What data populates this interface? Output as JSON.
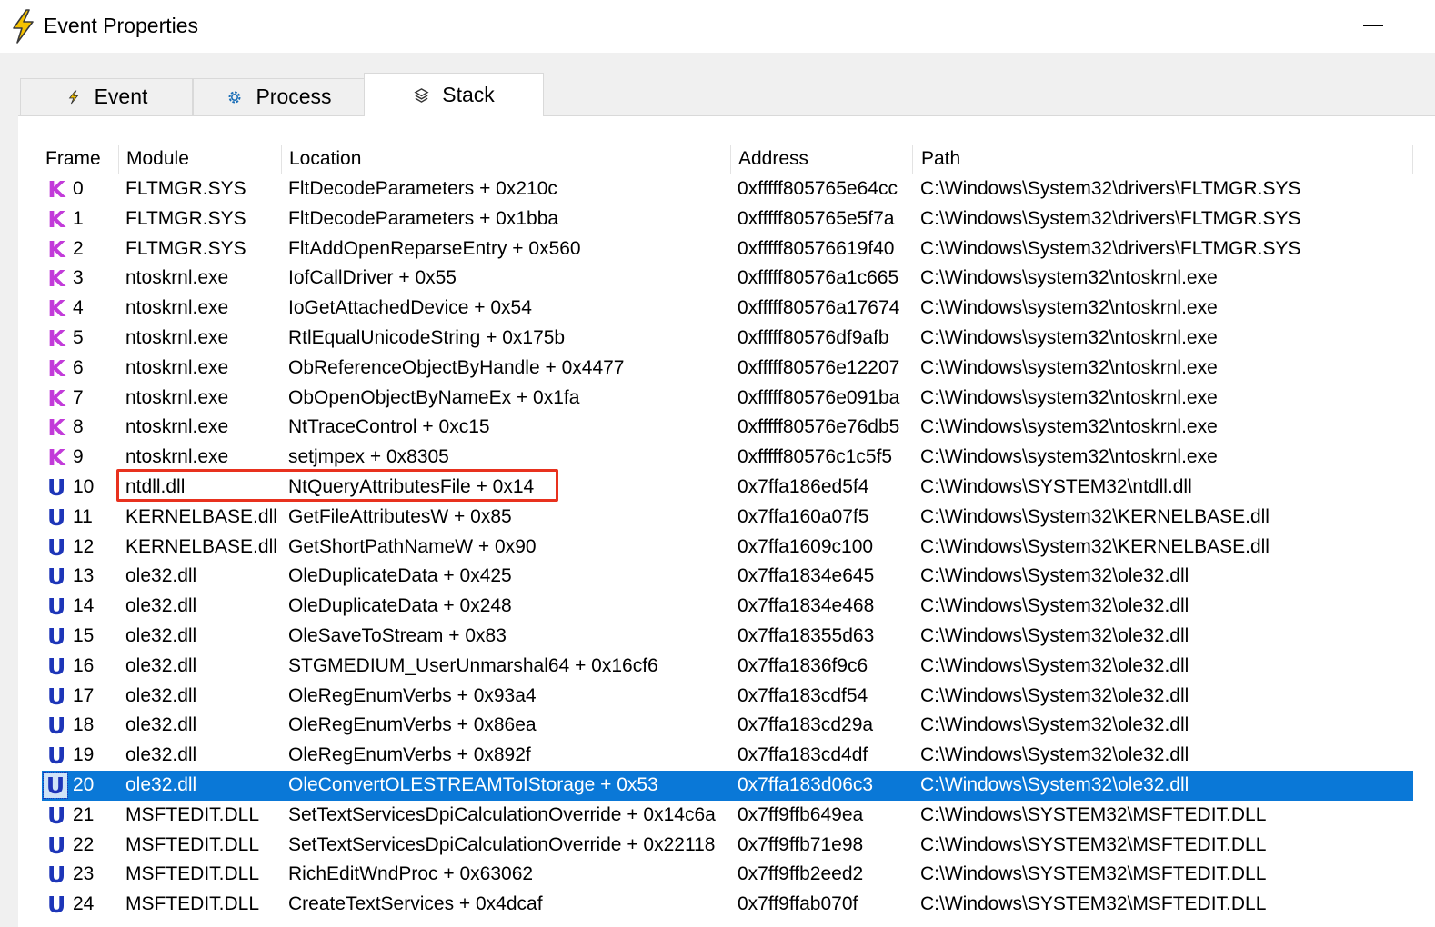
{
  "window": {
    "title": "Event Properties",
    "icon": "lightning-icon"
  },
  "tabs": [
    {
      "label": "Event",
      "icon": "lightning-icon",
      "active": false
    },
    {
      "label": "Process",
      "icon": "gear-icon",
      "active": false
    },
    {
      "label": "Stack",
      "icon": "layers-icon",
      "active": true
    }
  ],
  "table": {
    "columns": [
      "Frame",
      "Module",
      "Location",
      "Address",
      "Path"
    ],
    "selected_frame": "20",
    "highlighted_frame": "10",
    "rows": [
      {
        "mode": "K",
        "frame": "0",
        "module": "FLTMGR.SYS",
        "location": "FltDecodeParameters + 0x210c",
        "address": "0xfffff805765e64cc",
        "path": "C:\\Windows\\System32\\drivers\\FLTMGR.SYS"
      },
      {
        "mode": "K",
        "frame": "1",
        "module": "FLTMGR.SYS",
        "location": "FltDecodeParameters + 0x1bba",
        "address": "0xfffff805765e5f7a",
        "path": "C:\\Windows\\System32\\drivers\\FLTMGR.SYS"
      },
      {
        "mode": "K",
        "frame": "2",
        "module": "FLTMGR.SYS",
        "location": "FltAddOpenReparseEntry + 0x560",
        "address": "0xfffff80576619f40",
        "path": "C:\\Windows\\System32\\drivers\\FLTMGR.SYS"
      },
      {
        "mode": "K",
        "frame": "3",
        "module": "ntoskrnl.exe",
        "location": "IofCallDriver + 0x55",
        "address": "0xfffff80576a1c665",
        "path": "C:\\Windows\\system32\\ntoskrnl.exe"
      },
      {
        "mode": "K",
        "frame": "4",
        "module": "ntoskrnl.exe",
        "location": "IoGetAttachedDevice + 0x54",
        "address": "0xfffff80576a17674",
        "path": "C:\\Windows\\system32\\ntoskrnl.exe"
      },
      {
        "mode": "K",
        "frame": "5",
        "module": "ntoskrnl.exe",
        "location": "RtlEqualUnicodeString + 0x175b",
        "address": "0xfffff80576df9afb",
        "path": "C:\\Windows\\system32\\ntoskrnl.exe"
      },
      {
        "mode": "K",
        "frame": "6",
        "module": "ntoskrnl.exe",
        "location": "ObReferenceObjectByHandle + 0x4477",
        "address": "0xfffff80576e12207",
        "path": "C:\\Windows\\system32\\ntoskrnl.exe"
      },
      {
        "mode": "K",
        "frame": "7",
        "module": "ntoskrnl.exe",
        "location": "ObOpenObjectByNameEx + 0x1fa",
        "address": "0xfffff80576e091ba",
        "path": "C:\\Windows\\system32\\ntoskrnl.exe"
      },
      {
        "mode": "K",
        "frame": "8",
        "module": "ntoskrnl.exe",
        "location": "NtTraceControl + 0xc15",
        "address": "0xfffff80576e76db5",
        "path": "C:\\Windows\\system32\\ntoskrnl.exe"
      },
      {
        "mode": "K",
        "frame": "9",
        "module": "ntoskrnl.exe",
        "location": "setjmpex + 0x8305",
        "address": "0xfffff80576c1c5f5",
        "path": "C:\\Windows\\system32\\ntoskrnl.exe"
      },
      {
        "mode": "U",
        "frame": "10",
        "module": "ntdll.dll",
        "location": "NtQueryAttributesFile + 0x14",
        "address": "0x7ffa186ed5f4",
        "path": "C:\\Windows\\SYSTEM32\\ntdll.dll"
      },
      {
        "mode": "U",
        "frame": "11",
        "module": "KERNELBASE.dll",
        "location": "GetFileAttributesW + 0x85",
        "address": "0x7ffa160a07f5",
        "path": "C:\\Windows\\System32\\KERNELBASE.dll"
      },
      {
        "mode": "U",
        "frame": "12",
        "module": "KERNELBASE.dll",
        "location": "GetShortPathNameW + 0x90",
        "address": "0x7ffa1609c100",
        "path": "C:\\Windows\\System32\\KERNELBASE.dll"
      },
      {
        "mode": "U",
        "frame": "13",
        "module": "ole32.dll",
        "location": "OleDuplicateData + 0x425",
        "address": "0x7ffa1834e645",
        "path": "C:\\Windows\\System32\\ole32.dll"
      },
      {
        "mode": "U",
        "frame": "14",
        "module": "ole32.dll",
        "location": "OleDuplicateData + 0x248",
        "address": "0x7ffa1834e468",
        "path": "C:\\Windows\\System32\\ole32.dll"
      },
      {
        "mode": "U",
        "frame": "15",
        "module": "ole32.dll",
        "location": "OleSaveToStream + 0x83",
        "address": "0x7ffa18355d63",
        "path": "C:\\Windows\\System32\\ole32.dll"
      },
      {
        "mode": "U",
        "frame": "16",
        "module": "ole32.dll",
        "location": "STGMEDIUM_UserUnmarshal64 + 0x16cf6",
        "address": "0x7ffa1836f9c6",
        "path": "C:\\Windows\\System32\\ole32.dll"
      },
      {
        "mode": "U",
        "frame": "17",
        "module": "ole32.dll",
        "location": "OleRegEnumVerbs + 0x93a4",
        "address": "0x7ffa183cdf54",
        "path": "C:\\Windows\\System32\\ole32.dll"
      },
      {
        "mode": "U",
        "frame": "18",
        "module": "ole32.dll",
        "location": "OleRegEnumVerbs + 0x86ea",
        "address": "0x7ffa183cd29a",
        "path": "C:\\Windows\\System32\\ole32.dll"
      },
      {
        "mode": "U",
        "frame": "19",
        "module": "ole32.dll",
        "location": "OleRegEnumVerbs + 0x892f",
        "address": "0x7ffa183cd4df",
        "path": "C:\\Windows\\System32\\ole32.dll"
      },
      {
        "mode": "U",
        "frame": "20",
        "module": "ole32.dll",
        "location": "OleConvertOLESTREAMToIStorage + 0x53",
        "address": "0x7ffa183d06c3",
        "path": "C:\\Windows\\System32\\ole32.dll"
      },
      {
        "mode": "U",
        "frame": "21",
        "module": "MSFTEDIT.DLL",
        "location": "SetTextServicesDpiCalculationOverride + 0x14c6a",
        "address": "0x7ff9ffb649ea",
        "path": "C:\\Windows\\SYSTEM32\\MSFTEDIT.DLL"
      },
      {
        "mode": "U",
        "frame": "22",
        "module": "MSFTEDIT.DLL",
        "location": "SetTextServicesDpiCalculationOverride + 0x22118",
        "address": "0x7ff9ffb71e98",
        "path": "C:\\Windows\\SYSTEM32\\MSFTEDIT.DLL"
      },
      {
        "mode": "U",
        "frame": "23",
        "module": "MSFTEDIT.DLL",
        "location": "RichEditWndProc + 0x63062",
        "address": "0x7ff9ffb2eed2",
        "path": "C:\\Windows\\SYSTEM32\\MSFTEDIT.DLL"
      },
      {
        "mode": "U",
        "frame": "24",
        "module": "MSFTEDIT.DLL",
        "location": "CreateTextServices + 0x4dcaf",
        "address": "0x7ff9ffab070f",
        "path": "C:\\Windows\\SYSTEM32\\MSFTEDIT.DLL"
      }
    ]
  },
  "colors": {
    "kernel_badge": "#c23bd9",
    "user_badge": "#1d35b8",
    "selection": "#0a78d7",
    "highlight_box": "#e8311e"
  }
}
